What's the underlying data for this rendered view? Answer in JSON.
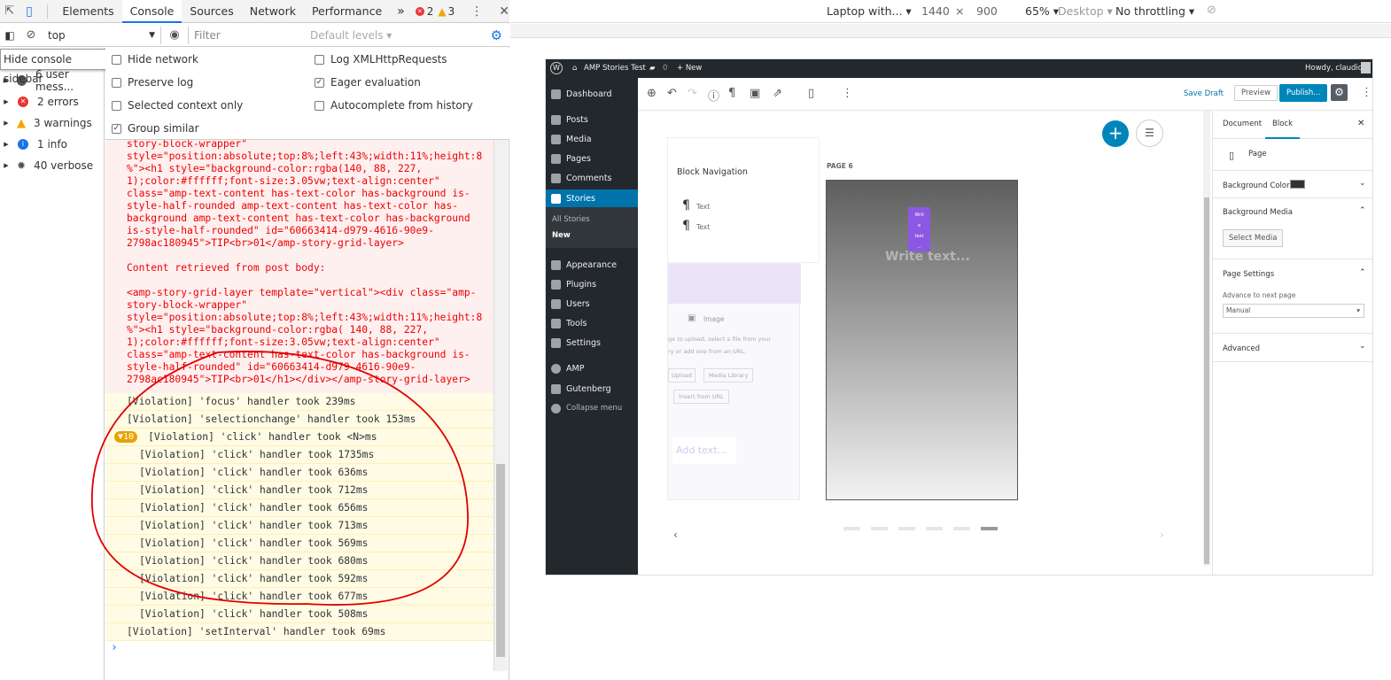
{
  "devtools": {
    "tabs": [
      "Elements",
      "Console",
      "Sources",
      "Network",
      "Performance"
    ],
    "more": "»",
    "error_count": "2",
    "warning_count": "3",
    "close": "✕",
    "toolbar": {
      "context": "top",
      "filter_placeholder": "Filter",
      "levels": "Default levels ▾"
    },
    "tooltip": "Hide console sidebar",
    "sidebar": [
      {
        "label": "6 user mess..."
      },
      {
        "label": "2 errors"
      },
      {
        "label": "3 warnings"
      },
      {
        "label": "1 info"
      },
      {
        "label": "40 verbose"
      }
    ],
    "settings": {
      "hide_network": "Hide network",
      "preserve_log": "Preserve log",
      "selected_context": "Selected context only",
      "group_similar": "Group similar",
      "log_xhr": "Log XMLHttpRequests",
      "eager": "Eager evaluation",
      "autocomplete": "Autocomplete from history"
    },
    "console": {
      "err1": "story-block-wrapper\"\nstyle=\"position:absolute;top:8%;left:43%;width:11%;height:8\n%\"><h1 style=\"background-color:rgba(140, 88, 227,\n1);color:#ffffff;font-size:3.05vw;text-align:center\"\nclass=\"amp-text-content has-text-color has-background is-\nstyle-half-rounded amp-text-content has-text-color has-\nbackground amp-text-content has-text-color has-background\nis-style-half-rounded\" id=\"60663414-d979-4616-90e9-\n2798ac180945\">TIP<br>01</amp-story-grid-layer>\n\nContent retrieved from post body:\n\n<amp-story-grid-layer template=\"vertical\"><div class=\"amp-\nstory-block-wrapper\"\nstyle=\"position:absolute;top:8%;left:43%;width:11%;height:8\n%\"><h1 style=\"background-color:rgba( 140, 88, 227,\n1);color:#ffffff;font-size:3.05vw;text-align:center\"\nclass=\"amp-text-content has-text-color has-background is-\nstyle-half-rounded\" id=\"60663414-d979-4616-90e9-\n2798ac180945\">TIP<br>01</h1></div></amp-story-grid-layer>",
      "v_focus": "[Violation] 'focus' handler took 239ms",
      "v_select": "[Violation] 'selectionchange' handler took 153ms",
      "group_badge": "▼10",
      "group_label": "[Violation] 'click' handler took <N>ms",
      "clicks": [
        "1735",
        "636",
        "712",
        "656",
        "713",
        "569",
        "680",
        "592",
        "677",
        "508"
      ],
      "click_prefix": "[Violation] 'click' handler took ",
      "click_suffix": "ms",
      "v_interval": "[Violation] 'setInterval' handler took 69ms",
      "prompt": "›"
    }
  },
  "emulation": {
    "device": "Laptop with... ▾",
    "width": "1440",
    "x": "×",
    "height": "900",
    "zoom": "65% ▾",
    "mode": "Desktop ▾",
    "throttle": "No throttling ▾"
  },
  "wp": {
    "adminbar": {
      "site": "AMP Stories Test",
      "comments": "0",
      "new": "+ New",
      "howdy": "Howdy, claudio"
    },
    "menu": [
      "Dashboard",
      "Posts",
      "Media",
      "Pages",
      "Comments",
      "Stories",
      "Appearance",
      "Plugins",
      "Users",
      "Tools",
      "Settings",
      "AMP",
      "Gutenberg",
      "Collapse menu"
    ],
    "submenu": [
      "All Stories",
      "New"
    ],
    "editor": {
      "save_draft": "Save Draft",
      "preview": "Preview",
      "publish": "Publish..."
    },
    "blocknav": {
      "title": "Block Navigation",
      "items": [
        "Text",
        "Text"
      ]
    },
    "page_label": "PAGE 6",
    "write_text": "Write text...",
    "mini_text": [
      "Writ",
      "e",
      "text",
      "..."
    ],
    "image": {
      "label": "Image",
      "help1": "ge to upload, select a file from your",
      "help2": "ry or add one from an URL.",
      "upload": "Upload",
      "library": "Media Library",
      "url": "Insert from URL"
    },
    "add_text": "Add text...",
    "sidebar": {
      "tab_doc": "Document",
      "tab_block": "Block",
      "close": "✕",
      "page": "Page",
      "bg_color": "Background Color",
      "bg_media": "Background Media",
      "select_media": "Select Media",
      "page_settings": "Page Settings",
      "advance": "Advance to next page",
      "manual": "Manual",
      "advanced": "Advanced"
    },
    "colors": {
      "accent": "#0085ba",
      "purple": "#8c58e3",
      "admin": "#23282d"
    }
  }
}
